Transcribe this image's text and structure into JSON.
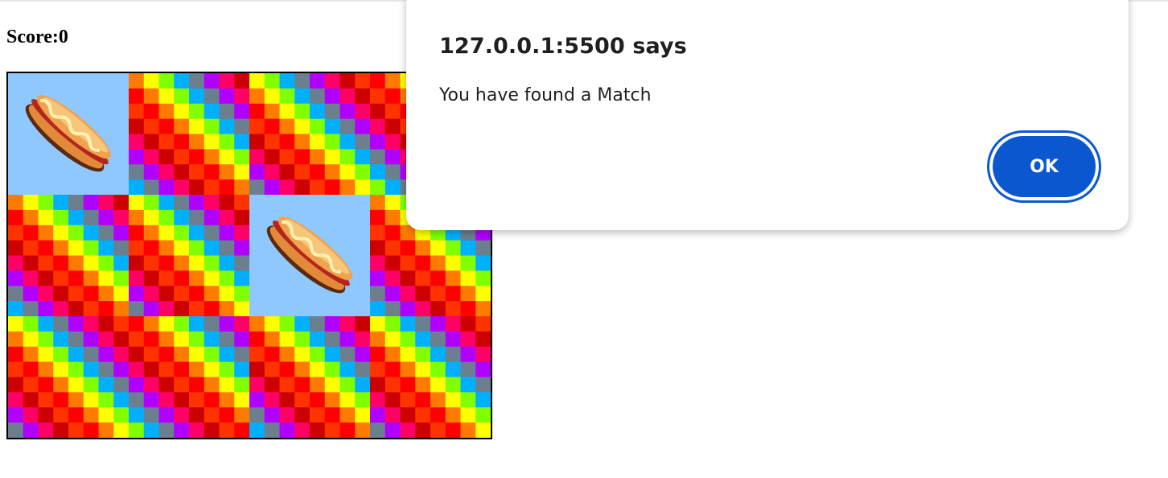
{
  "game": {
    "score_text": "Score:0",
    "grid_rows": 3,
    "grid_cols": 4,
    "cards": [
      {
        "state": "face-up",
        "item": "hotdog-icon"
      },
      {
        "state": "face-down",
        "item": null
      },
      {
        "state": "face-down",
        "item": null
      },
      {
        "state": "face-down",
        "item": null
      },
      {
        "state": "face-down",
        "item": null
      },
      {
        "state": "face-down",
        "item": null
      },
      {
        "state": "face-up",
        "item": "hotdog-icon"
      },
      {
        "state": "face-down",
        "item": null
      },
      {
        "state": "face-down",
        "item": null
      },
      {
        "state": "face-down",
        "item": null
      },
      {
        "state": "face-down",
        "item": null
      },
      {
        "state": "face-down",
        "item": null
      }
    ],
    "card_back_colors": [
      "#ff0000",
      "#ff7a00",
      "#ffff00",
      "#7fff00",
      "#00b0ff",
      "#6b7f8f",
      "#b000ff",
      "#ff0066",
      "#cc0000",
      "#ff3300"
    ],
    "face_up_background": "#8ec8ff"
  },
  "dialog": {
    "title": "127.0.0.1:5500 says",
    "message": "You have found a Match",
    "ok_label": "OK",
    "accent_color": "#0b57d0"
  }
}
